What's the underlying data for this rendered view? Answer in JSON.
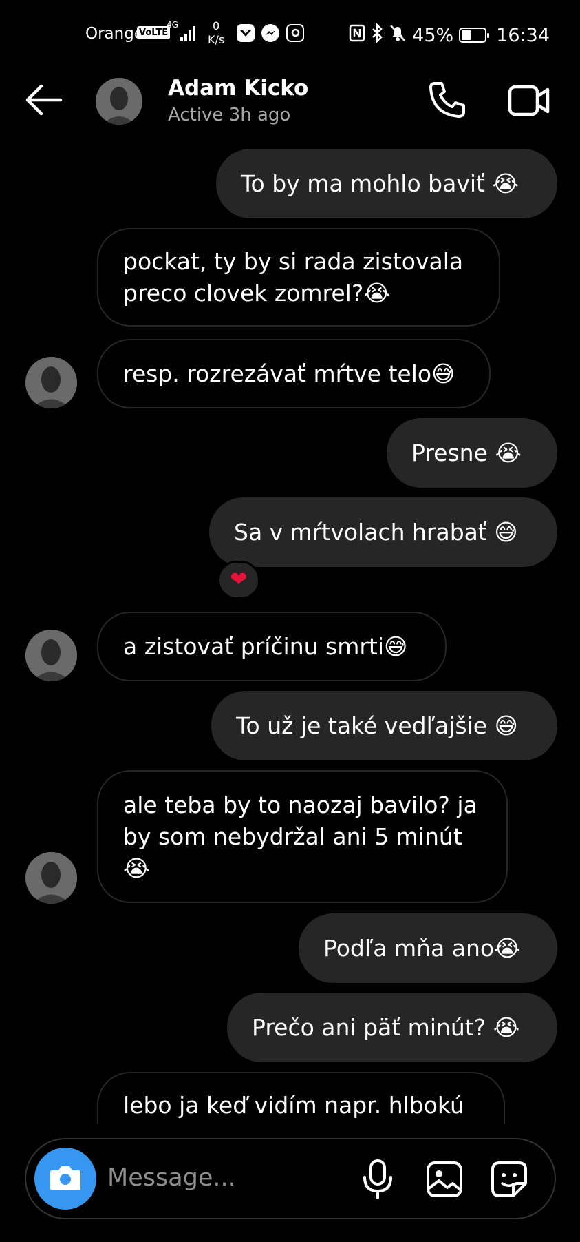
{
  "status_bar": {
    "carrier": "Orange",
    "volte": "VoLTE",
    "network": "4G",
    "speed_value": "0",
    "speed_unit": "K/s",
    "app_icons": [
      "messenger-icon",
      "messenger-icon",
      "instagram-icon"
    ],
    "battery": "45%",
    "battery_level": 0.45,
    "time": "16:34"
  },
  "header": {
    "name": "Adam Kicko",
    "status": "Active 3h ago"
  },
  "messages": [
    {
      "side": "sent",
      "text": "To by ma mohlo baviť 😭"
    },
    {
      "side": "received",
      "text": "pockat, ty by si rada zistovala preco clovek zomrel?😭"
    },
    {
      "side": "received",
      "text": "resp. rozrezávať mŕtve telo😅"
    },
    {
      "side": "sent",
      "text": "Presne 😭"
    },
    {
      "side": "sent",
      "text": "Sa v mŕtvolach hrabať 😅",
      "reaction": "❤"
    },
    {
      "side": "received",
      "text": "a zistovať príčinu smrti😅"
    },
    {
      "side": "sent",
      "text": "To už je také vedľajšie 😅"
    },
    {
      "side": "received",
      "text": "ale teba by to naozaj bavilo? ja by som nebydržal ani 5 minút 😭"
    },
    {
      "side": "sent",
      "text": "Podľa mňa ano😭"
    },
    {
      "side": "sent",
      "text": "Prečo ani päť minút? 😭"
    },
    {
      "side": "received",
      "text": "lebo ja keď vidím napr. hlbokú"
    }
  ],
  "composer": {
    "placeholder": "Message..."
  },
  "colors": {
    "background": "#000000",
    "sent_bubble": "#262626",
    "received_border": "#262626",
    "camera_button": "#3797f0",
    "muted_text": "#a8a8a8"
  }
}
